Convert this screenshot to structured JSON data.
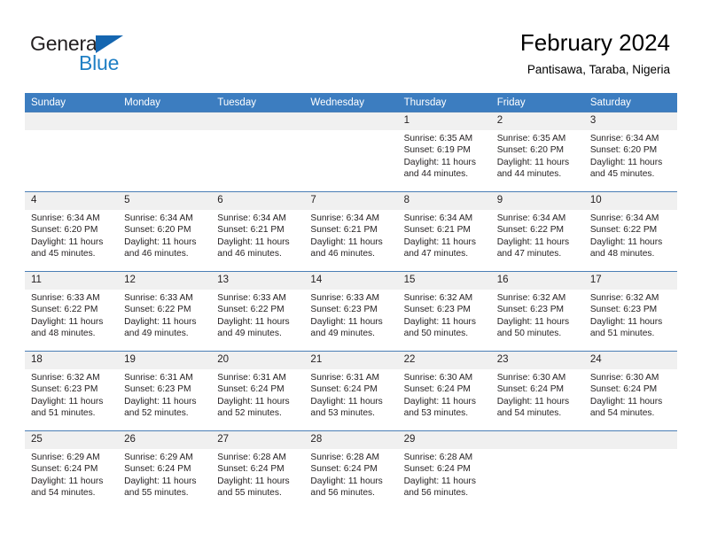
{
  "logo": {
    "primary_text": "General",
    "secondary_text": "Blue",
    "primary_color": "#231f20",
    "secondary_color": "#1f7fc4",
    "triangle_color": "#1566b0",
    "icon": "triangle-icon"
  },
  "header": {
    "title": "February 2024",
    "subtitle": "Pantisawa, Taraba, Nigeria"
  },
  "theme": {
    "header_row_bg": "#3c7dc0",
    "header_row_text": "#ffffff",
    "daynum_bg": "#f0f0f0",
    "cell_border": "#4a7eb5",
    "text": "#231f20"
  },
  "weekdays": [
    "Sunday",
    "Monday",
    "Tuesday",
    "Wednesday",
    "Thursday",
    "Friday",
    "Saturday"
  ],
  "weeks": [
    [
      {
        "day": "",
        "empty": true
      },
      {
        "day": "",
        "empty": true
      },
      {
        "day": "",
        "empty": true
      },
      {
        "day": "",
        "empty": true
      },
      {
        "day": "1",
        "sunrise": "Sunrise: 6:35 AM",
        "sunset": "Sunset: 6:19 PM",
        "daylight": "Daylight: 11 hours and 44 minutes."
      },
      {
        "day": "2",
        "sunrise": "Sunrise: 6:35 AM",
        "sunset": "Sunset: 6:20 PM",
        "daylight": "Daylight: 11 hours and 44 minutes."
      },
      {
        "day": "3",
        "sunrise": "Sunrise: 6:34 AM",
        "sunset": "Sunset: 6:20 PM",
        "daylight": "Daylight: 11 hours and 45 minutes."
      }
    ],
    [
      {
        "day": "4",
        "sunrise": "Sunrise: 6:34 AM",
        "sunset": "Sunset: 6:20 PM",
        "daylight": "Daylight: 11 hours and 45 minutes."
      },
      {
        "day": "5",
        "sunrise": "Sunrise: 6:34 AM",
        "sunset": "Sunset: 6:20 PM",
        "daylight": "Daylight: 11 hours and 46 minutes."
      },
      {
        "day": "6",
        "sunrise": "Sunrise: 6:34 AM",
        "sunset": "Sunset: 6:21 PM",
        "daylight": "Daylight: 11 hours and 46 minutes."
      },
      {
        "day": "7",
        "sunrise": "Sunrise: 6:34 AM",
        "sunset": "Sunset: 6:21 PM",
        "daylight": "Daylight: 11 hours and 46 minutes."
      },
      {
        "day": "8",
        "sunrise": "Sunrise: 6:34 AM",
        "sunset": "Sunset: 6:21 PM",
        "daylight": "Daylight: 11 hours and 47 minutes."
      },
      {
        "day": "9",
        "sunrise": "Sunrise: 6:34 AM",
        "sunset": "Sunset: 6:22 PM",
        "daylight": "Daylight: 11 hours and 47 minutes."
      },
      {
        "day": "10",
        "sunrise": "Sunrise: 6:34 AM",
        "sunset": "Sunset: 6:22 PM",
        "daylight": "Daylight: 11 hours and 48 minutes."
      }
    ],
    [
      {
        "day": "11",
        "sunrise": "Sunrise: 6:33 AM",
        "sunset": "Sunset: 6:22 PM",
        "daylight": "Daylight: 11 hours and 48 minutes."
      },
      {
        "day": "12",
        "sunrise": "Sunrise: 6:33 AM",
        "sunset": "Sunset: 6:22 PM",
        "daylight": "Daylight: 11 hours and 49 minutes."
      },
      {
        "day": "13",
        "sunrise": "Sunrise: 6:33 AM",
        "sunset": "Sunset: 6:22 PM",
        "daylight": "Daylight: 11 hours and 49 minutes."
      },
      {
        "day": "14",
        "sunrise": "Sunrise: 6:33 AM",
        "sunset": "Sunset: 6:23 PM",
        "daylight": "Daylight: 11 hours and 49 minutes."
      },
      {
        "day": "15",
        "sunrise": "Sunrise: 6:32 AM",
        "sunset": "Sunset: 6:23 PM",
        "daylight": "Daylight: 11 hours and 50 minutes."
      },
      {
        "day": "16",
        "sunrise": "Sunrise: 6:32 AM",
        "sunset": "Sunset: 6:23 PM",
        "daylight": "Daylight: 11 hours and 50 minutes."
      },
      {
        "day": "17",
        "sunrise": "Sunrise: 6:32 AM",
        "sunset": "Sunset: 6:23 PM",
        "daylight": "Daylight: 11 hours and 51 minutes."
      }
    ],
    [
      {
        "day": "18",
        "sunrise": "Sunrise: 6:32 AM",
        "sunset": "Sunset: 6:23 PM",
        "daylight": "Daylight: 11 hours and 51 minutes."
      },
      {
        "day": "19",
        "sunrise": "Sunrise: 6:31 AM",
        "sunset": "Sunset: 6:23 PM",
        "daylight": "Daylight: 11 hours and 52 minutes."
      },
      {
        "day": "20",
        "sunrise": "Sunrise: 6:31 AM",
        "sunset": "Sunset: 6:24 PM",
        "daylight": "Daylight: 11 hours and 52 minutes."
      },
      {
        "day": "21",
        "sunrise": "Sunrise: 6:31 AM",
        "sunset": "Sunset: 6:24 PM",
        "daylight": "Daylight: 11 hours and 53 minutes."
      },
      {
        "day": "22",
        "sunrise": "Sunrise: 6:30 AM",
        "sunset": "Sunset: 6:24 PM",
        "daylight": "Daylight: 11 hours and 53 minutes."
      },
      {
        "day": "23",
        "sunrise": "Sunrise: 6:30 AM",
        "sunset": "Sunset: 6:24 PM",
        "daylight": "Daylight: 11 hours and 54 minutes."
      },
      {
        "day": "24",
        "sunrise": "Sunrise: 6:30 AM",
        "sunset": "Sunset: 6:24 PM",
        "daylight": "Daylight: 11 hours and 54 minutes."
      }
    ],
    [
      {
        "day": "25",
        "sunrise": "Sunrise: 6:29 AM",
        "sunset": "Sunset: 6:24 PM",
        "daylight": "Daylight: 11 hours and 54 minutes."
      },
      {
        "day": "26",
        "sunrise": "Sunrise: 6:29 AM",
        "sunset": "Sunset: 6:24 PM",
        "daylight": "Daylight: 11 hours and 55 minutes."
      },
      {
        "day": "27",
        "sunrise": "Sunrise: 6:28 AM",
        "sunset": "Sunset: 6:24 PM",
        "daylight": "Daylight: 11 hours and 55 minutes."
      },
      {
        "day": "28",
        "sunrise": "Sunrise: 6:28 AM",
        "sunset": "Sunset: 6:24 PM",
        "daylight": "Daylight: 11 hours and 56 minutes."
      },
      {
        "day": "29",
        "sunrise": "Sunrise: 6:28 AM",
        "sunset": "Sunset: 6:24 PM",
        "daylight": "Daylight: 11 hours and 56 minutes."
      },
      {
        "day": "",
        "empty": true
      },
      {
        "day": "",
        "empty": true
      }
    ]
  ]
}
